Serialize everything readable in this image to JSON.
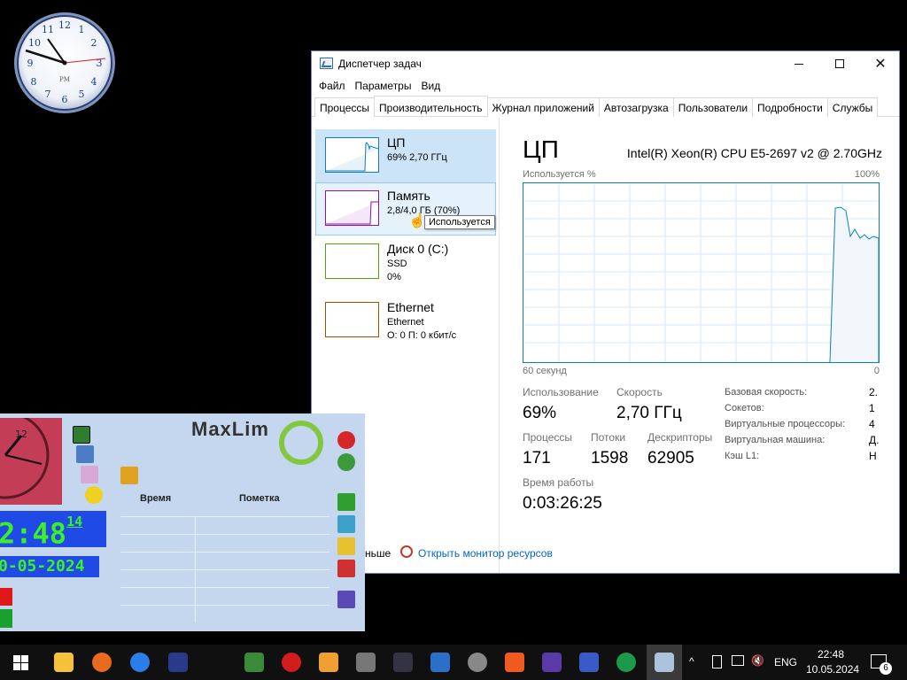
{
  "clock_gadget": {
    "numerals": [
      "12",
      "1",
      "2",
      "3",
      "4",
      "5",
      "6",
      "7",
      "8",
      "9",
      "10",
      "11"
    ],
    "pm_label": "PM"
  },
  "task_manager": {
    "window_title": "Диспетчер задач",
    "menu": [
      "Файл",
      "Параметры",
      "Вид"
    ],
    "tabs": [
      "Процессы",
      "Производительность",
      "Журнал приложений",
      "Автозагрузка",
      "Пользователи",
      "Подробности",
      "Службы"
    ],
    "active_tab": "Производительность",
    "side_items": [
      {
        "title": "ЦП",
        "sub1": "69% 2,70 ГГц",
        "sub2": "",
        "color": "#117dbb"
      },
      {
        "title": "Память",
        "sub1": "2,8/4,0 ГБ (70%)",
        "sub2": "",
        "color": "#8b12ae"
      },
      {
        "title": "Диск 0 (C:)",
        "sub1": "SSD",
        "sub2": "0%",
        "color": "#4da60c"
      },
      {
        "title": "Ethernet",
        "sub1": "Ethernet",
        "sub2": "О: 0 П: 0 кбит/с",
        "color": "#a74f01"
      }
    ],
    "tooltip": "Используется",
    "cpu": {
      "heading": "ЦП",
      "model": "Intel(R) Xeon(R) CPU E5-2697 v2 @ 2.70GHz",
      "graph_label": "Используется %",
      "graph_max": "100%",
      "graph_time": "60 секунд",
      "graph_min": "0",
      "usage_label": "Использование",
      "usage_value": "69%",
      "speed_label": "Скорость",
      "speed_value": "2,70 ГГц",
      "processes_label": "Процессы",
      "processes_value": "171",
      "threads_label": "Потоки",
      "threads_value": "1598",
      "handles_label": "Дескрипторы",
      "handles_value": "62905",
      "uptime_label": "Время работы",
      "uptime_value": "0:03:26:25",
      "details": [
        {
          "label": "Базовая скорость:",
          "value": "2."
        },
        {
          "label": "Сокетов:",
          "value": "1"
        },
        {
          "label": "Виртуальные процессоры:",
          "value": "4"
        },
        {
          "label": "Виртуальная машина:",
          "value": "Д."
        },
        {
          "label": "Кэш L1:",
          "value": "Н"
        }
      ]
    },
    "footer_less": "ньше",
    "footer_link": "Открыть монитор ресурсов"
  },
  "maxlim": {
    "brand": "MaxLim",
    "time": "2:48",
    "seconds": "14",
    "date": "0-05-2024",
    "col_time": "Время",
    "col_note": "Пометка"
  },
  "taskbar": {
    "lang": "ENG",
    "time": "22:48",
    "date": "10.05.2024",
    "notif_count": "6"
  }
}
